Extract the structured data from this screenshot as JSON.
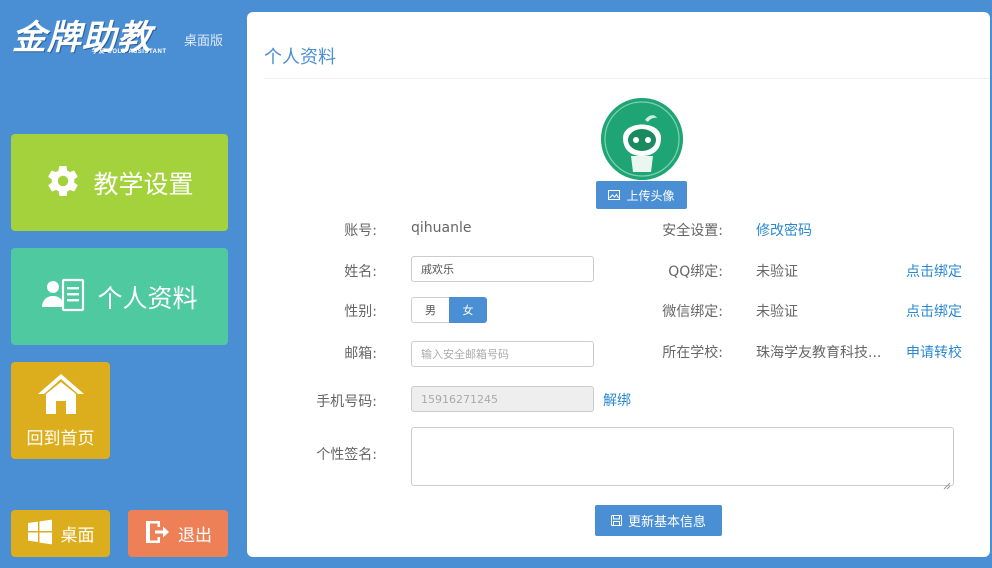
{
  "app": {
    "logo_text": "金牌助教",
    "logo_sub": "学友  GOLD ASSISTANT",
    "edition": "桌面版"
  },
  "sidebar": {
    "teach_settings": "教学设置",
    "profile": "个人资料",
    "home": "回到首页",
    "desktop": "桌面",
    "exit": "退出"
  },
  "profile": {
    "title": "个人资料",
    "upload_label": "上传头像",
    "account_label": "账号:",
    "account_value": "qihuanle",
    "name_label": "姓名:",
    "name_value": "戚欢乐",
    "gender_label": "性别:",
    "gender_male": "男",
    "gender_female": "女",
    "gender_selected": "女",
    "email_label": "邮箱:",
    "email_placeholder": "输入安全邮箱号码",
    "phone_label": "手机号码:",
    "phone_value": "15916271245",
    "unbind": "解绑",
    "signature_label": "个性签名:",
    "signature_value": "",
    "security_label": "安全设置:",
    "change_password": "修改密码",
    "qq_label": "QQ绑定:",
    "qq_status": "未验证",
    "qq_action": "点击绑定",
    "wechat_label": "微信绑定:",
    "wechat_status": "未验证",
    "wechat_action": "点击绑定",
    "school_label": "所在学校:",
    "school_value": "珠海学友教育科技...",
    "school_action": "申请转校",
    "save_label": "更新基本信息"
  },
  "colors": {
    "background": "#4a8fd4",
    "teach_tile": "#a4d23c",
    "profile_tile": "#4ec9a0",
    "home_tile": "#dcae1d",
    "exit_tile": "#ee8057",
    "accent": "#4a8fd4"
  }
}
